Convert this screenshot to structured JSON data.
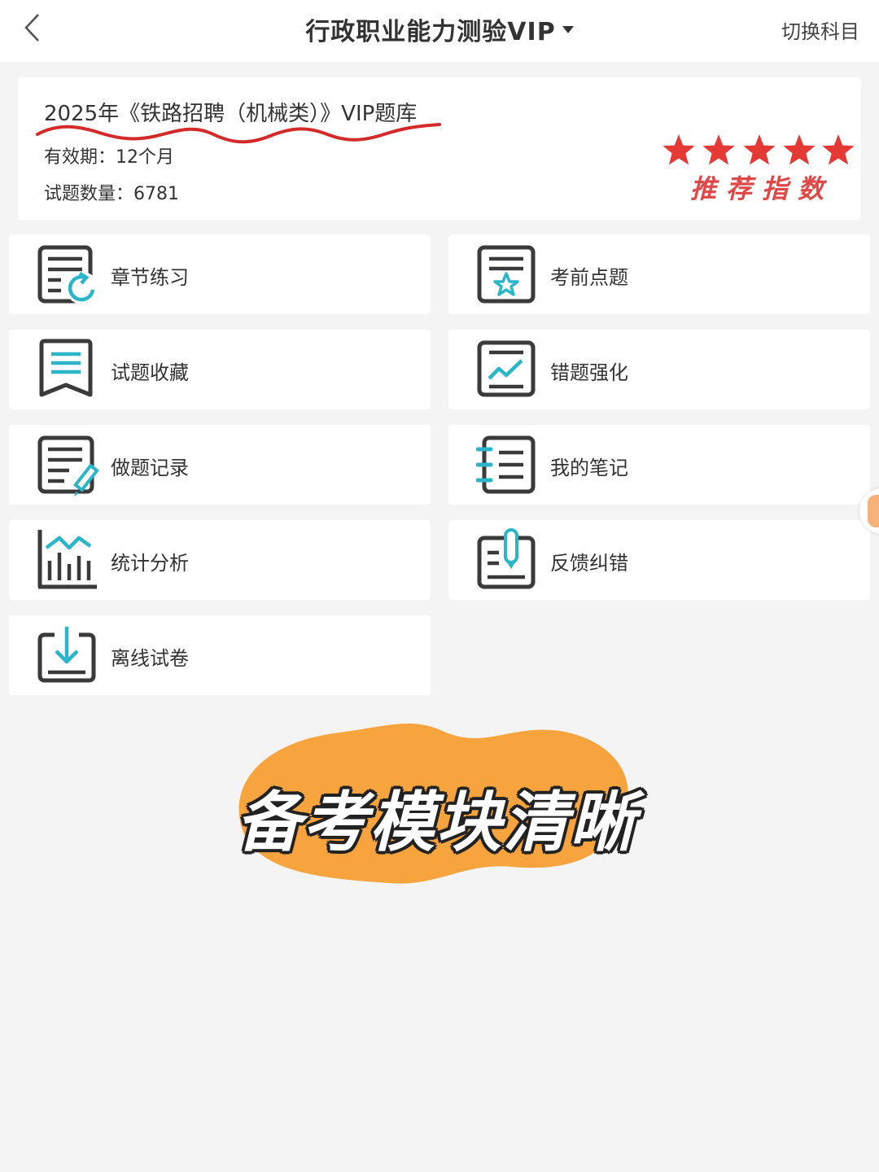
{
  "header": {
    "title": "行政职业能力测验VIP",
    "switch_label": "切换科目"
  },
  "bank": {
    "name": "2025年《铁路招聘（机械类）》VIP题库",
    "validity": "有效期：12个月",
    "question_count": "试题数量：6781",
    "rating_stars": 5,
    "rating_label": "推荐指数",
    "highlight_color": "#d42a2a"
  },
  "modules": [
    {
      "label": "章节练习",
      "icon": "chapter-practice-icon"
    },
    {
      "label": "考前点题",
      "icon": "star-document-icon"
    },
    {
      "label": "试题收藏",
      "icon": "bookmark-icon"
    },
    {
      "label": "错题强化",
      "icon": "trend-board-icon"
    },
    {
      "label": "做题记录",
      "icon": "edit-record-icon"
    },
    {
      "label": "我的笔记",
      "icon": "notebook-icon"
    },
    {
      "label": "统计分析",
      "icon": "bar-chart-icon"
    },
    {
      "label": "反馈纠错",
      "icon": "feedback-icon"
    },
    {
      "label": "离线试卷",
      "icon": "download-icon"
    }
  ],
  "overlay": {
    "caption": "备考模块清晰",
    "blob_color": "#f7a43f"
  },
  "colors": {
    "icon_dark": "#3a3a3a",
    "icon_accent": "#2bb5c8",
    "star_red": "#e53935"
  }
}
